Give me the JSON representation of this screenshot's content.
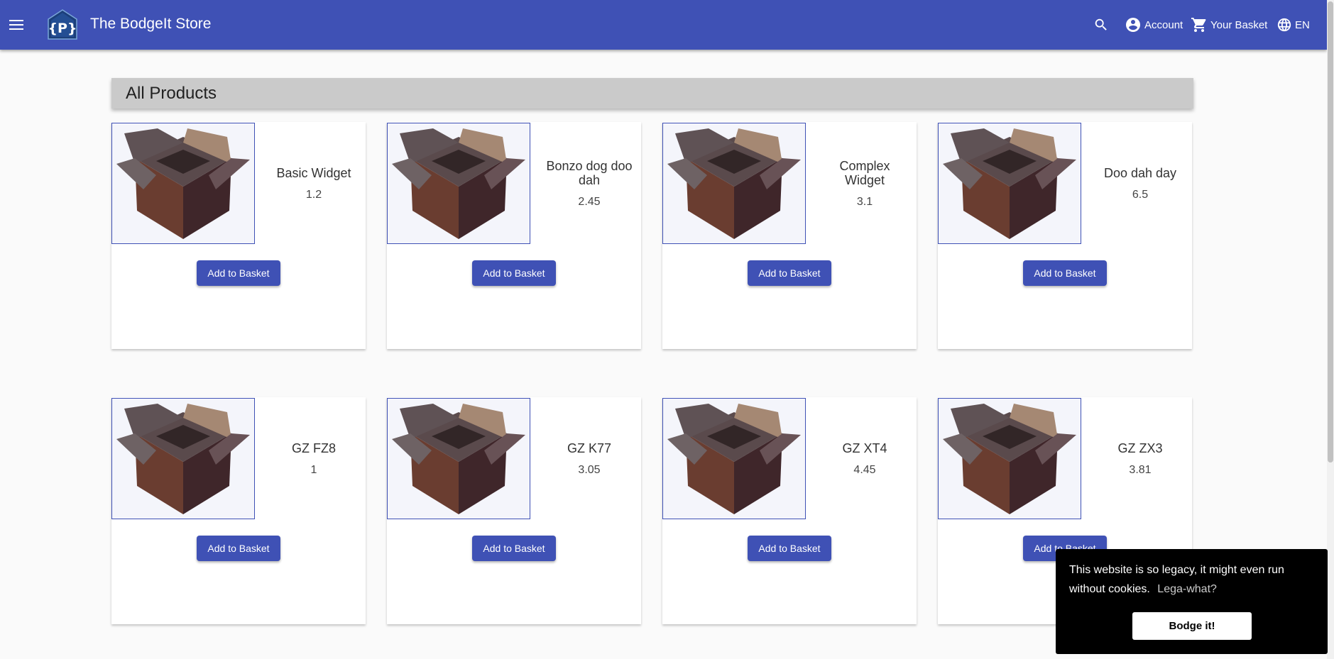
{
  "app": {
    "title": "The BodgeIt Store",
    "logo_text": "{P}",
    "accent": "#3f51b5"
  },
  "toolbar": {
    "menu_icon": "menu-icon",
    "search_icon": "search-icon",
    "account_label": "Account",
    "basket_label": "Your Basket",
    "language_label": "EN"
  },
  "page": {
    "title": "All Products"
  },
  "products": [
    {
      "name": "Basic Widget",
      "price": "1.2",
      "button": "Add to Basket"
    },
    {
      "name": "Bonzo dog doo dah",
      "price": "2.45",
      "button": "Add to Basket"
    },
    {
      "name": "Complex Widget",
      "price": "3.1",
      "button": "Add to Basket"
    },
    {
      "name": "Doo dah day",
      "price": "6.5",
      "button": "Add to Basket"
    },
    {
      "name": "GZ FZ8",
      "price": "1",
      "button": "Add to Basket"
    },
    {
      "name": "GZ K77",
      "price": "3.05",
      "button": "Add to Basket"
    },
    {
      "name": "GZ XT4",
      "price": "4.45",
      "button": "Add to Basket"
    },
    {
      "name": "GZ ZX3",
      "price": "3.81",
      "button": "Add to Basket"
    }
  ],
  "cookie": {
    "message": "This website is so legacy, it might even run without cookies.",
    "link_text": "Lega-what?",
    "button": "Bodge it!"
  }
}
